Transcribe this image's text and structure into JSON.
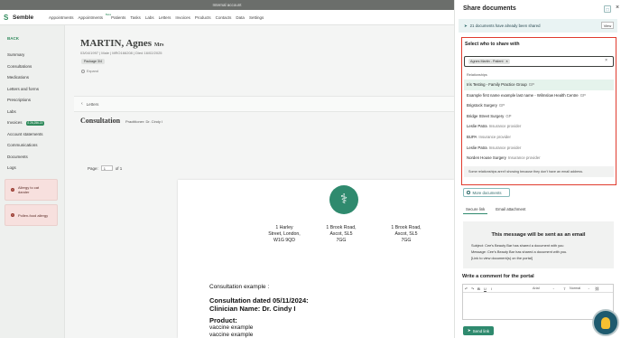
{
  "banner": {
    "text": "Internal account"
  },
  "brand": {
    "name": "Semble",
    "accent": "#2f8a5b"
  },
  "nav": {
    "items": [
      "Appointments",
      "Appointments",
      "Patients",
      "Tasks",
      "Labs",
      "Letters",
      "Invoices",
      "Products",
      "Contacts",
      "Data",
      "Settings"
    ],
    "beta_badge": "Beta",
    "active": "Patients"
  },
  "sidebar": {
    "back": "BACK",
    "items": [
      {
        "label": "Summary"
      },
      {
        "label": "Consultations"
      },
      {
        "label": "Medications"
      },
      {
        "label": "Letters and forms"
      },
      {
        "label": "Prescriptions"
      },
      {
        "label": "Labs"
      },
      {
        "label": "Invoices",
        "badge": "£ 26,256.22"
      },
      {
        "label": "Account statements"
      },
      {
        "label": "Communications"
      },
      {
        "label": "Documents"
      },
      {
        "label": "Logs"
      }
    ],
    "alerts": [
      "Allergy to cat dander",
      "Pollen-food allergy"
    ]
  },
  "patient": {
    "name": "MARTIN, Agnes",
    "title": "Mrs",
    "meta": "03/04/1997 | Male | MRO166208 | Died 16/02/2025",
    "package": "Package 3/4",
    "expand": "Expand"
  },
  "breadcrumb": "Letters",
  "consultation": {
    "title": "Consultation",
    "practitioner": "Practitioner: Dr. Cindy I"
  },
  "pager": {
    "page_label": "Page:",
    "page": "1",
    "of": "of 1"
  },
  "document": {
    "addresses": [
      [
        "1 Harley",
        "Street, London,",
        "W1G 9QD"
      ],
      [
        "1 Brook Road,",
        "Ascot, SL5",
        "7GG"
      ],
      [
        "1 Brook Road,",
        "Ascot, SL5",
        "7GG"
      ]
    ],
    "example_line": "Consultation example :",
    "dated": "Consultation dated 05/11/2024:",
    "clinician": "Clinician Name: Dr. Cindy I",
    "product_label": "Product:",
    "products": [
      "vaccine example",
      "vaccine example"
    ]
  },
  "panel": {
    "title": "Share documents",
    "shared_note": "21 documents have already been shared",
    "view_btn": "View",
    "select_label": "Select who to share with",
    "chip": "Agnes Martin - Patient",
    "relationships_header": "Relationships",
    "relationships": [
      {
        "name": "Iris Testing - Family Practice Group",
        "type": "GP"
      },
      {
        "name": "Example first name example last name - Wilmslow Health Centre",
        "type": "GP"
      },
      {
        "name": "Brigstock Surgery",
        "type": "GP"
      },
      {
        "name": "Bridge Street Surgery",
        "type": "GP"
      },
      {
        "name": "Leslie Patra",
        "type": "Insurance provider"
      },
      {
        "name": "BUPA",
        "type": "Insurance provider"
      },
      {
        "name": "Leslie Patra",
        "type": "Insurance provider"
      },
      {
        "name": "Norden House Surgery",
        "type": "Insurance provider"
      }
    ],
    "dropdown_note": "Some relationships aren't showing because they don't have an email address.",
    "more_docs": "More documents",
    "tabs": [
      "Secure link",
      "Email attachment"
    ],
    "message_title": "This message will be sent as an email",
    "message_lines": [
      "Subject: Cee's Beauty Bar has shared a document with you",
      "Message: Cee's Beauty Bar has shared a document with you.",
      "[Link to view document(s) on the portal]"
    ],
    "comment_label": "Write a comment for the portal",
    "editor": {
      "font": "Arial",
      "size": "Normal"
    },
    "send_btn": "Send link"
  }
}
